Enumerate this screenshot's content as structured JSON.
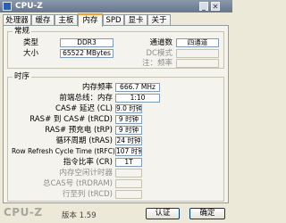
{
  "window": {
    "title": "CPU-Z"
  },
  "tabs": [
    "处理器",
    "缓存",
    "主板",
    "内存",
    "SPD",
    "显卡",
    "关于"
  ],
  "general": {
    "legend": "常规",
    "type_label": "类型",
    "type_value": "DDR3",
    "size_label": "大小",
    "size_value": "65522 MBytes",
    "channels_label": "通道数",
    "channels_value": "四通道",
    "dc_mode_label": "DC模式",
    "nb_freq_label": "注：频率"
  },
  "timings": {
    "legend": "时序",
    "rows": [
      {
        "label": "内存频率",
        "value": "666.7 MHz"
      },
      {
        "label": "前端总线：内存",
        "value": "1:10"
      },
      {
        "label": "CAS# 延迟 (CL)",
        "value": "9.0 时钟"
      },
      {
        "label": "RAS# 到 CAS# (tRCD)",
        "value": "9 时钟"
      },
      {
        "label": "RAS# 预充电 (tRP)",
        "value": "9 时钟"
      },
      {
        "label": "循环周期 (tRAS)",
        "value": "24 时钟"
      },
      {
        "label": "Row Refresh Cycle Time (tRFC)",
        "value": "107 时钟"
      },
      {
        "label": "指令比率 (CR)",
        "value": "1T"
      },
      {
        "label": "内存空闲计时器",
        "value": ""
      },
      {
        "label": "总CAS号 (tRDRAM)",
        "value": ""
      },
      {
        "label": "行至列 (tRCD)",
        "value": ""
      }
    ]
  },
  "footer": {
    "brand": "CPU-Z",
    "version_label": "版本 1.59",
    "ok_label": "认证",
    "close_label": "确定"
  }
}
